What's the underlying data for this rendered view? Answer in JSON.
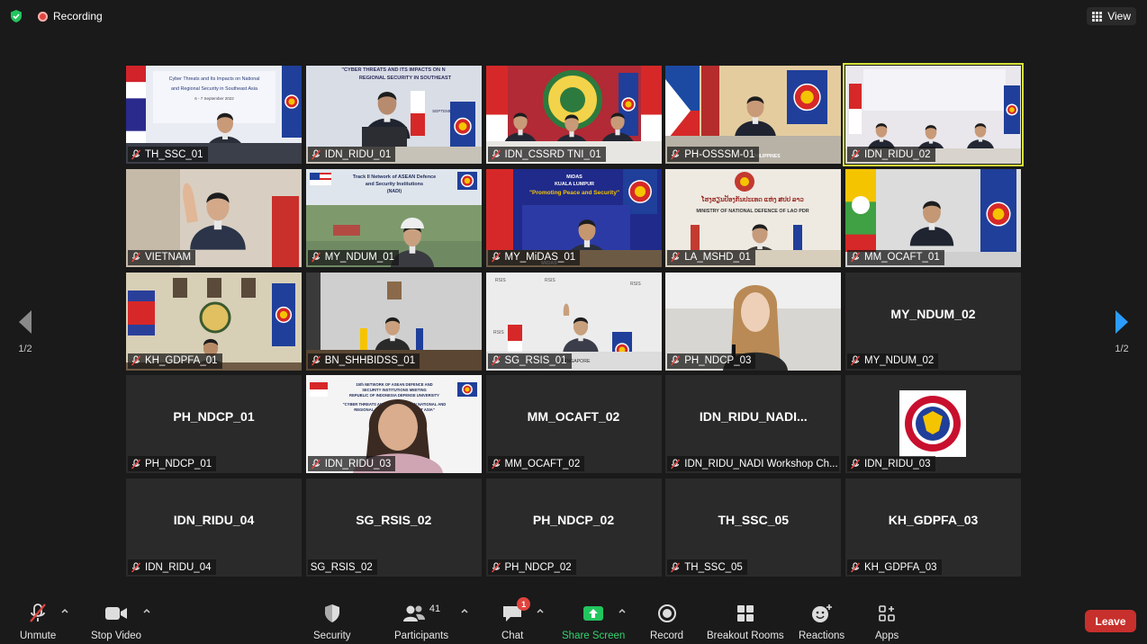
{
  "top": {
    "recording_label": "Recording",
    "view_label": "View"
  },
  "navigation": {
    "page_left": "1/2",
    "page_right": "1/2"
  },
  "tiles": [
    {
      "name": "TH_SSC_01",
      "video": true,
      "scene": "th"
    },
    {
      "name": "IDN_RIDU_01",
      "video": true,
      "scene": "idn1"
    },
    {
      "name": "IDN_CSSRD TNI_01",
      "video": true,
      "scene": "tni"
    },
    {
      "name": "PH-OSSSM-01",
      "video": true,
      "scene": "ph"
    },
    {
      "name": "IDN_RIDU_02",
      "video": true,
      "scene": "idn2",
      "active": true
    },
    {
      "name": "VIETNAM",
      "video": true,
      "scene": "vn"
    },
    {
      "name": "MY_NDUM_01",
      "video": true,
      "scene": "my1"
    },
    {
      "name": "MY_MiDAS_01",
      "video": true,
      "scene": "midas"
    },
    {
      "name": "LA_MSHD_01",
      "video": true,
      "scene": "la"
    },
    {
      "name": "MM_OCAFT_01",
      "video": true,
      "scene": "mm"
    },
    {
      "name": "KH_GDPFA_01",
      "video": true,
      "scene": "kh"
    },
    {
      "name": "BN_SHHBIDSS_01",
      "video": true,
      "scene": "bn"
    },
    {
      "name": "SG_RSIS_01",
      "video": true,
      "scene": "sg"
    },
    {
      "name": "PH_NDCP_03",
      "video": true,
      "scene": "ndcp3"
    },
    {
      "name": "MY_NDUM_02",
      "video": false,
      "display": "MY_NDUM_02"
    },
    {
      "name": "PH_NDCP_01",
      "video": false,
      "display": "PH_NDCP_01"
    },
    {
      "name": "IDN_RIDU_03",
      "video": true,
      "scene": "idn3"
    },
    {
      "name": "MM_OCAFT_02",
      "video": false,
      "display": "MM_OCAFT_02"
    },
    {
      "name": "IDN_RIDU_NADI Workshop Ch...",
      "video": false,
      "display": "IDN_RIDU_NADI..."
    },
    {
      "name": "IDN_RIDU_03",
      "video": false,
      "logo": true,
      "scene": "logo"
    },
    {
      "name": "IDN_RIDU_04",
      "video": false,
      "display": "IDN_RIDU_04"
    },
    {
      "name": "SG_RSIS_02",
      "video": false,
      "display": "SG_RSIS_02",
      "mic_ok": true
    },
    {
      "name": "PH_NDCP_02",
      "video": false,
      "display": "PH_NDCP_02"
    },
    {
      "name": "TH_SSC_05",
      "video": false,
      "display": "TH_SSC_05"
    },
    {
      "name": "KH_GDPFA_03",
      "video": false,
      "display": "KH_GDPFA_03"
    }
  ],
  "scene_text": {
    "th_line1": "Cyber Threats and Its Impacts on National",
    "th_line2": "and Regional Security in Southeast Asia",
    "th_line3": "6 - 7 September 2022",
    "idn1_line1": "\"CYBER THREATS AND ITS IMPACTS ON N",
    "idn1_line2": "REGIONAL SECURITY IN SOUTHEAST",
    "idn1_line3": "SEPTEMBER 2022",
    "my1_line1": "Track II Network of ASEAN Defence",
    "my1_line2": "and Security Institutions",
    "my1_line3": "(NADI)",
    "midas_line1": "MiDAS",
    "midas_line2": "KUALA LUMPUR",
    "midas_line3": "\"Promoting Peace and Security\"",
    "midas_line4": "MiDAS",
    "la_line1": "ໂຮງຮຽນປ້ອງກັນປະເທດ ແຫ່ງ ສປປ ລາວ",
    "la_line2": "MINISTRY OF NATIONAL DEFENCE OF LAO PDR",
    "idn3_line1": "15th NETWORK OF ASEAN DEFENCE AND",
    "idn3_line2": "SECURITY INSTITUTIONS MEETING",
    "idn3_line3": "REPUBLIC OF INDONESIA DEFENSE UNIVERSITY",
    "idn3_line4": "\"CYBER THREATS AND ITS IMPACTS ON NATIONAL AND",
    "idn3_line5": "REGIONAL SECURITY IN SOUTHEAST ASIA\"",
    "sg_rsis": "RSIS",
    "sg_plate": "SINGAPORE",
    "ph_plate": "PHILIPPINES",
    "logo_text": "UNIVERSITAS PERTAHANAN REPUBLIK INDONESIA"
  },
  "toolbar": {
    "unmute": "Unmute",
    "stop_video": "Stop Video",
    "security": "Security",
    "participants": "Participants",
    "participants_count": "41",
    "chat": "Chat",
    "chat_badge": "1",
    "share_screen": "Share Screen",
    "record": "Record",
    "breakout_rooms": "Breakout Rooms",
    "reactions": "Reactions",
    "apps": "Apps",
    "leave": "Leave"
  },
  "colors": {
    "background": "#1a1a1a",
    "tile_empty": "#2a2a2a",
    "active_speaker": "#d7e33a",
    "share_green": "#22c55e",
    "leave_red": "#c7302c",
    "mute_red": "#e0443e",
    "nav_blue": "#2b9cff"
  }
}
